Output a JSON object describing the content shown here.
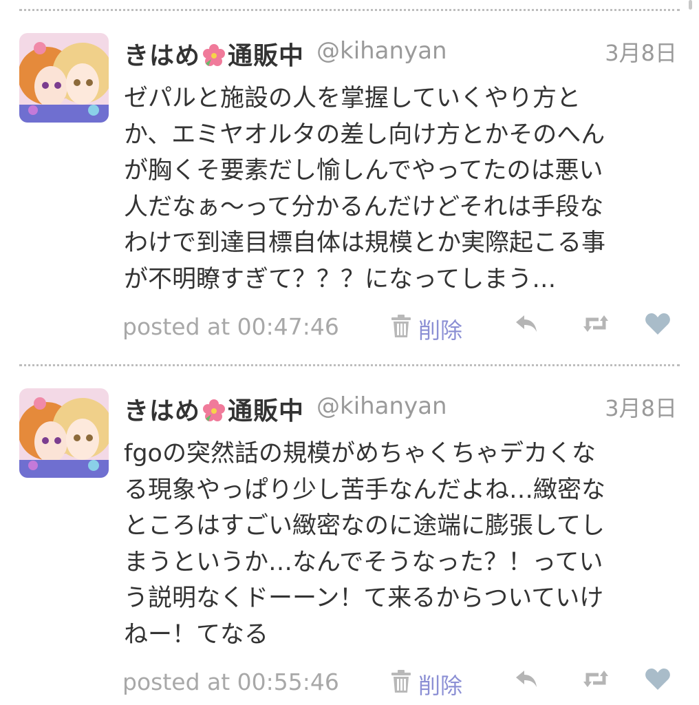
{
  "colors": {
    "delete_link": "#8b8fd4",
    "muted_text": "#9a9a9a",
    "body_text": "#333333",
    "icon_gray": "#b5b5b5",
    "heart": "#a9bcc9"
  },
  "tweets": [
    {
      "display_name": "きはめ",
      "name_emoji": "flower-icon",
      "name_suffix": "通販中",
      "handle": "@kihanyan",
      "date": "3月8日",
      "lines": [
        "ゼパルと施設の人を掌握していくやり方と",
        "か、エミヤオルタの差し向け方とかそのへん",
        "が胸くそ要素だし愉しんでやってたのは悪い",
        "人だなぁ〜って分かるんだけどそれは手段な",
        "わけで到達目標自体は規模とか実際起こる事",
        "が不明瞭すぎて？？？になってしまう…"
      ],
      "posted_at": "posted at 00:47:46",
      "delete_label": "削除"
    },
    {
      "display_name": "きはめ",
      "name_emoji": "flower-icon",
      "name_suffix": "通販中",
      "handle": "@kihanyan",
      "date": "3月8日",
      "lines": [
        "fgoの突然話の規模がめちゃくちゃデカくな",
        "る現象やっぱり少し苦手なんだよね…緻密な",
        "ところはすごい緻密なのに途端に膨張してし",
        "まうというか…なんでそうなった？！ってい",
        "う説明なくドーーン！て来るからついていけ",
        "ねー！てなる"
      ],
      "posted_at": "posted at 00:55:46",
      "delete_label": "削除"
    }
  ]
}
